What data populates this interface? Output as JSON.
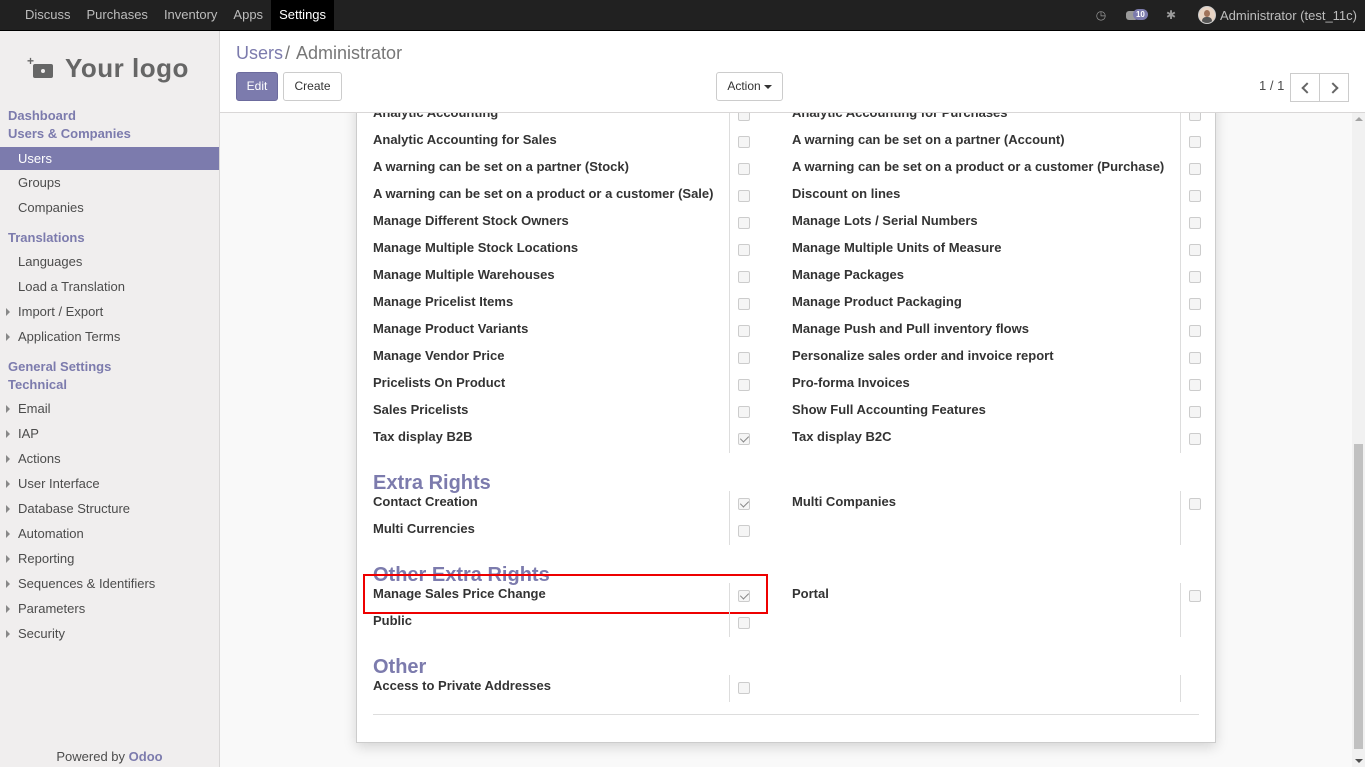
{
  "topbar": {
    "menu": [
      "Discuss",
      "Purchases",
      "Inventory",
      "Apps",
      "Settings"
    ],
    "active": "Settings",
    "chat_count": "10",
    "user": "Administrator (test_11c)"
  },
  "sidebar": {
    "logo_text": "Your logo",
    "sections": {
      "dashboard": "Dashboard",
      "users_companies": "Users & Companies",
      "translations": "Translations",
      "general_settings": "General Settings",
      "technical": "Technical"
    },
    "users_items": [
      "Users",
      "Groups",
      "Companies"
    ],
    "translation_items": [
      "Languages",
      "Load a Translation",
      "Import / Export",
      "Application Terms"
    ],
    "technical_items": [
      "Email",
      "IAP",
      "Actions",
      "User Interface",
      "Database Structure",
      "Automation",
      "Reporting",
      "Sequences & Identifiers",
      "Parameters",
      "Security"
    ],
    "powered_by": "Powered by",
    "powered_brand": "Odoo"
  },
  "control_panel": {
    "breadcrumb_parent": "Users",
    "breadcrumb_sep": "/",
    "breadcrumb_current": "Administrator",
    "edit_label": "Edit",
    "create_label": "Create",
    "action_label": "Action",
    "pager": "1 / 1"
  },
  "technical_rows": [
    {
      "left": "Analytic Accounting",
      "left_checked": false,
      "right": "Analytic Accounting for Purchases",
      "right_checked": false
    },
    {
      "left": "Analytic Accounting for Sales",
      "left_checked": false,
      "right": "A warning can be set on a partner (Account)",
      "right_checked": false
    },
    {
      "left": "A warning can be set on a partner (Stock)",
      "left_checked": false,
      "right": "A warning can be set on a product or a customer (Purchase)",
      "right_checked": false
    },
    {
      "left": "A warning can be set on a product or a customer (Sale)",
      "left_checked": false,
      "right": "Discount on lines",
      "right_checked": false
    },
    {
      "left": "Manage Different Stock Owners",
      "left_checked": false,
      "right": "Manage Lots / Serial Numbers",
      "right_checked": false
    },
    {
      "left": "Manage Multiple Stock Locations",
      "left_checked": false,
      "right": "Manage Multiple Units of Measure",
      "right_checked": false
    },
    {
      "left": "Manage Multiple Warehouses",
      "left_checked": false,
      "right": "Manage Packages",
      "right_checked": false
    },
    {
      "left": "Manage Pricelist Items",
      "left_checked": false,
      "right": "Manage Product Packaging",
      "right_checked": false
    },
    {
      "left": "Manage Product Variants",
      "left_checked": false,
      "right": "Manage Push and Pull inventory flows",
      "right_checked": false
    },
    {
      "left": "Manage Vendor Price",
      "left_checked": false,
      "right": "Personalize sales order and invoice report",
      "right_checked": false
    },
    {
      "left": "Pricelists On Product",
      "left_checked": false,
      "right": "Pro-forma Invoices",
      "right_checked": false
    },
    {
      "left": "Sales Pricelists",
      "left_checked": false,
      "right": "Show Full Accounting Features",
      "right_checked": false
    },
    {
      "left": "Tax display B2B",
      "left_checked": true,
      "right": "Tax display B2C",
      "right_checked": false
    }
  ],
  "extra_rights": {
    "title": "Extra Rights",
    "rows": [
      {
        "left": "Contact Creation",
        "left_checked": true,
        "right": "Multi Companies",
        "right_checked": false
      },
      {
        "left": "Multi Currencies",
        "left_checked": false
      }
    ]
  },
  "other_extra_rights": {
    "title": "Other Extra Rights",
    "rows": [
      {
        "left": "Manage Sales Price Change",
        "left_checked": true,
        "right": "Portal",
        "right_checked": false
      },
      {
        "left": "Public",
        "left_checked": false
      }
    ]
  },
  "other": {
    "title": "Other",
    "rows": [
      {
        "left": "Access to Private Addresses",
        "left_checked": false
      }
    ]
  },
  "colors": {
    "accent": "#7c7bad",
    "highlight": "#ee0000",
    "topbar": "#212121"
  }
}
